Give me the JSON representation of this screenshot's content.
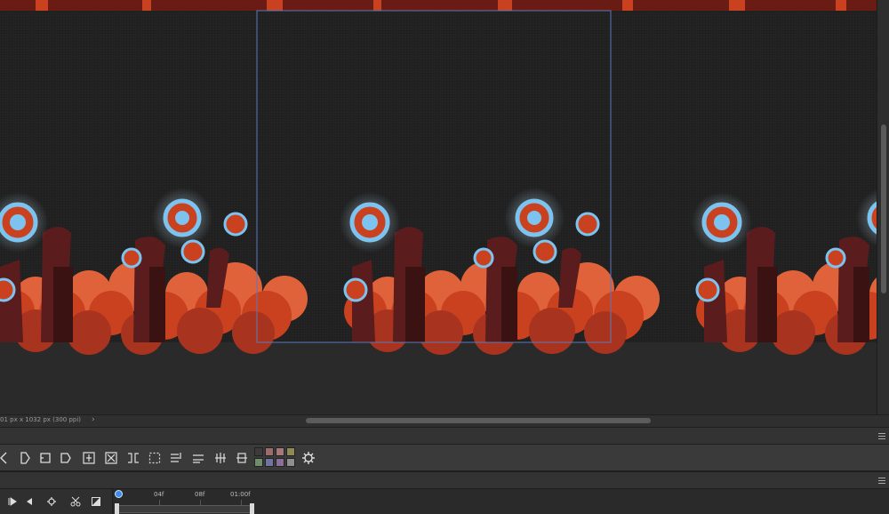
{
  "canvas": {
    "background_color": "#232323",
    "frame_border_color": "#5b78b8",
    "crowd_colors": [
      "#c9411f",
      "#e0623a",
      "#a8331e",
      "#5a1c1c",
      "#3a1212"
    ],
    "light_color": "#7cc4ef"
  },
  "status_bar": {
    "document_info": "01 px x 1032 px (300 ppi)",
    "expand_icon": "chevron-right-icon"
  },
  "toolbar": {
    "buttons": [
      "bracket-left-icon",
      "bracket-right-icon",
      "page-left-icon",
      "page-right-icon",
      "fit-height-icon",
      "fit-cross-icon",
      "split-icon",
      "select-dotted-icon",
      "align-text-icon",
      "distribute-icon",
      "distribute-vertical-icon",
      "distribute-horizontal-icon",
      "settings-gear-icon"
    ],
    "swatches": [
      "#3b3b3b",
      "#9b6c6c",
      "#a5787a",
      "#9d7a6a",
      "#8e8a58",
      "#6e8f6a",
      "#6f74a1",
      "#8a6f99",
      "#8e8e8e"
    ]
  },
  "timeline": {
    "buttons": [
      "play-icon",
      "previous-frame-icon",
      "onion-settings-icon",
      "cut-scissors-icon",
      "light-table-icon"
    ],
    "ticks": [
      "04f",
      "08f",
      "01:00f"
    ],
    "accent_color": "#3a8ee6"
  }
}
